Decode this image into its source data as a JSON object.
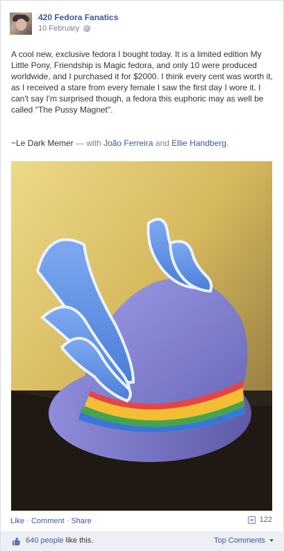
{
  "post": {
    "page_name": "420 Fedora Fanatics",
    "date": "10 February",
    "privacy_icon": "globe-icon",
    "text": "A cool new, exclusive fedora I bought today. It is a limited edition My Little Pony, Friendship is Magic fedora, and only 10 were produced worldwide, and I purchased it for $2000. I think every cent was worth it, as I received a stare from every female I saw the first day I wore it. I can't say I'm surprised though, a fedora this euphoric may as well be called \"The Pussy Magnet\".",
    "signoff_prefix": "~Le Dark Memer",
    "signoff_with": "— with",
    "tag_1": "João Ferreira",
    "signoff_and": "and",
    "tag_2": "Ellie Handberg."
  },
  "actions": {
    "like": "Like",
    "comment": "Comment",
    "share": "Share",
    "share_count": "122"
  },
  "likes": {
    "count_text": "640 people",
    "suffix": " like this.",
    "top_comments": "Top Comments"
  },
  "colors": {
    "link": "#3b5998",
    "muted": "#7f7f7f",
    "bar_bg": "#edeff4"
  }
}
